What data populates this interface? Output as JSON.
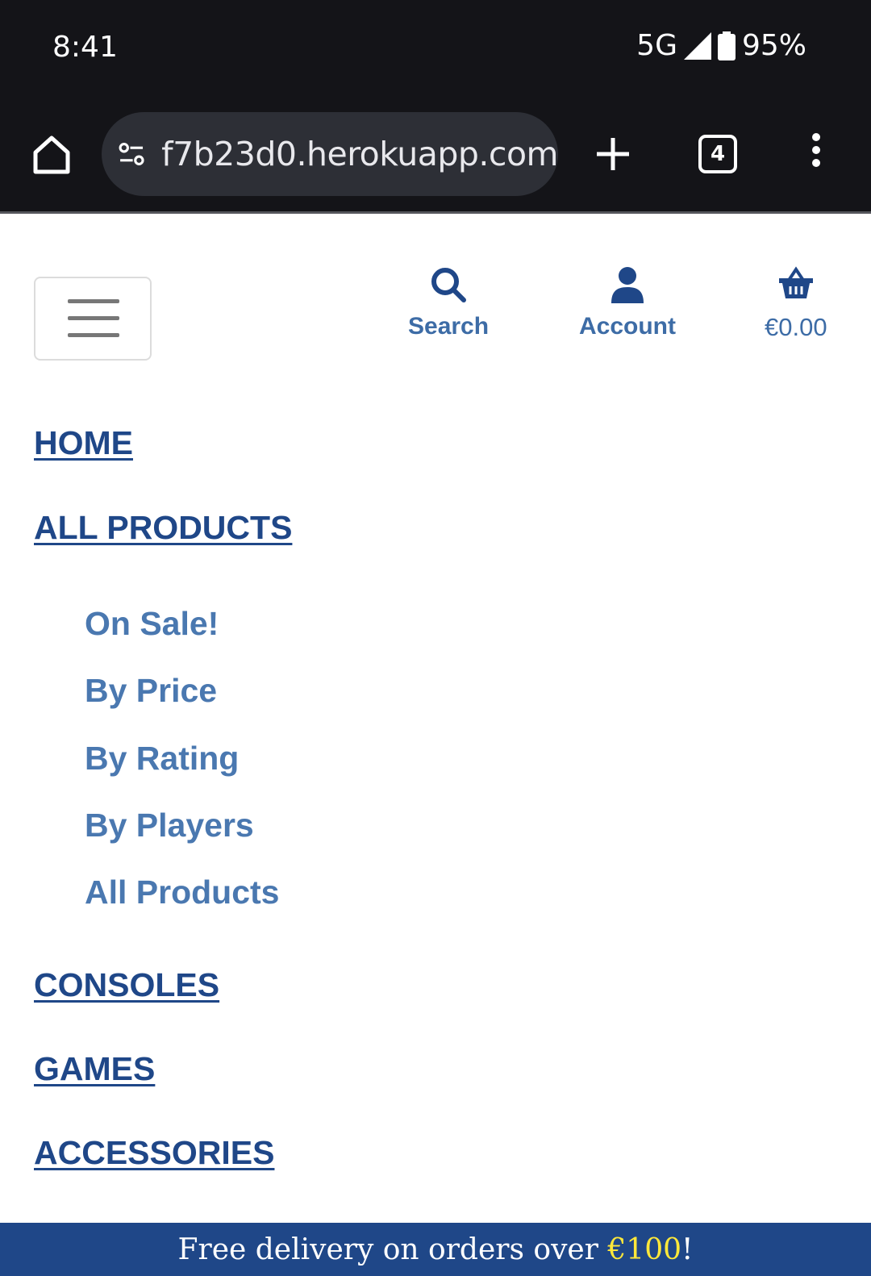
{
  "status_bar": {
    "time": "8:41",
    "network": "5G",
    "battery": "95%"
  },
  "browser": {
    "url": "f7b23d0.herokuapp.com",
    "tab_count": "4"
  },
  "header": {
    "search_label": "Search",
    "account_label": "Account",
    "cart_total": "€0.00"
  },
  "nav": {
    "home": "HOME",
    "all_products": "ALL PRODUCTS",
    "sub_items": [
      "On Sale!",
      "By Price",
      "By Rating",
      "By Players",
      "All Products"
    ],
    "consoles": "CONSOLES",
    "games": "GAMES",
    "accessories": "ACCESSORIES"
  },
  "banner": {
    "prefix": "Free delivery on orders over ",
    "amount": "€100",
    "suffix": "!"
  },
  "colors": {
    "brand": "#1f4788",
    "link_light": "#4a78b0",
    "highlight": "#ffe83a"
  }
}
